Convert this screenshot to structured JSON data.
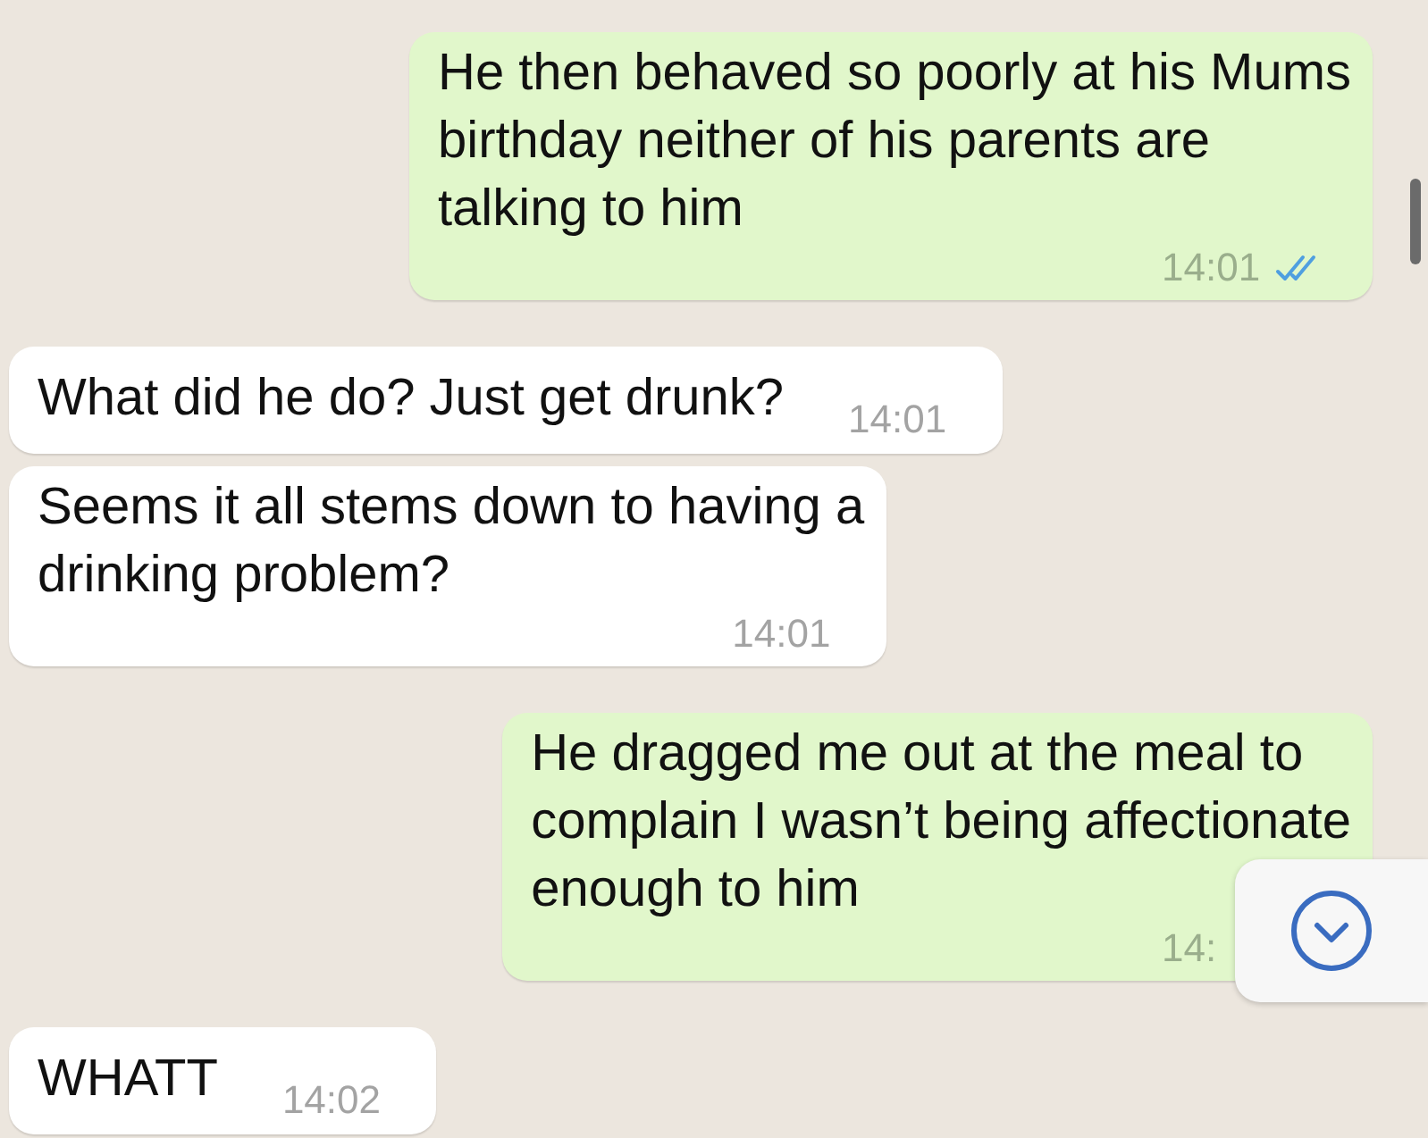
{
  "messages": [
    {
      "kind": "sent",
      "lines": [
        "He then behaved so poorly at his Mums",
        "birthday neither of his parents are",
        "talking to him"
      ],
      "time": "14:01",
      "read": true
    },
    {
      "kind": "received",
      "lines": [
        "What did he do? Just get drunk?"
      ],
      "time": "14:01"
    },
    {
      "kind": "received",
      "lines": [
        "Seems it all stems down to having a",
        "drinking problem?"
      ],
      "time": "14:01"
    },
    {
      "kind": "sent",
      "lines": [
        "He dragged me out at the meal to",
        "complain I wasn’t being affectionate",
        "enough to him"
      ],
      "time": "14:"
    },
    {
      "kind": "received",
      "lines": [
        "WHATT"
      ],
      "time": "14:02"
    }
  ]
}
